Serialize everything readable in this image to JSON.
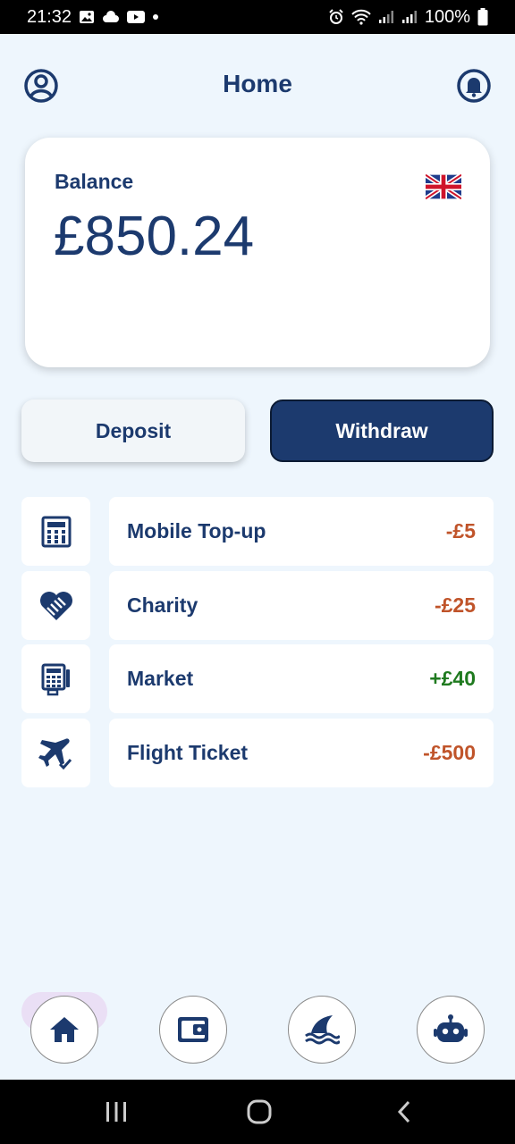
{
  "status_bar": {
    "time": "21:32",
    "battery": "100%"
  },
  "header": {
    "title": "Home"
  },
  "balance": {
    "label": "Balance",
    "amount": "£850.24",
    "currency_flag": "uk-flag-icon"
  },
  "actions": {
    "deposit_label": "Deposit",
    "withdraw_label": "Withdraw"
  },
  "transactions": [
    {
      "icon": "calculator-icon",
      "name": "Mobile Top-up",
      "amount": "-£5",
      "color": "#c0542a"
    },
    {
      "icon": "heart-handshake-icon",
      "name": "Charity",
      "amount": "-£25",
      "color": "#c0542a"
    },
    {
      "icon": "cash-register-icon",
      "name": "Market",
      "amount": "+£40",
      "color": "#1f7a1f"
    },
    {
      "icon": "plane-check-icon",
      "name": "Flight Ticket",
      "amount": "-£500",
      "color": "#c0542a"
    }
  ],
  "nav": {
    "items": [
      "home-icon",
      "wallet-icon",
      "shark-fin-icon",
      "robot-icon"
    ],
    "active": "home-icon"
  },
  "colors": {
    "primary": "#1c3a6e",
    "background": "#eef6fd",
    "negative": "#c0542a",
    "positive": "#1f7a1f"
  }
}
